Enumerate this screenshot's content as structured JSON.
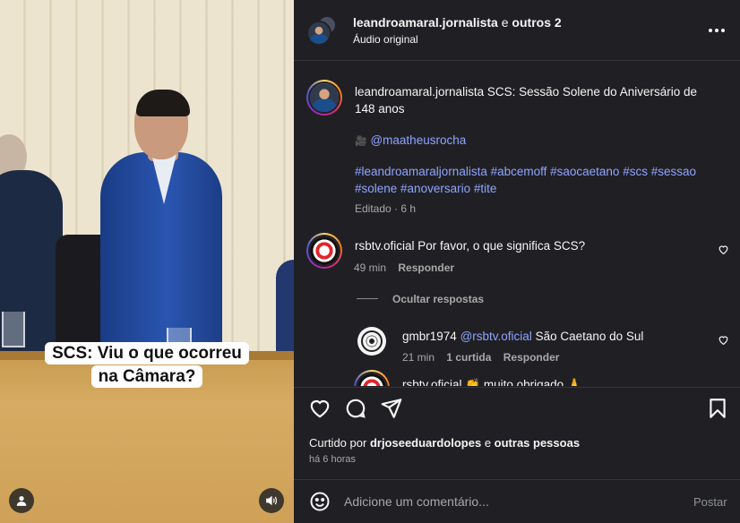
{
  "video": {
    "caption_line1": "SCS: Viu o que ocorreu",
    "caption_line2": "na Câmara?"
  },
  "header": {
    "username": "leandroamaral.jornalista",
    "collab_connector": "e",
    "collab_others": "outros 2",
    "audio": "Áudio original"
  },
  "caption_post": {
    "username": "leandroamaral.jornalista",
    "text": "SCS: Sessão Solene do Aniversário de 148 anos",
    "mention_emoji": "🎥",
    "mention": "@maatheusrocha",
    "hashtags_line1": "#leandroamaraljornalista #abcemoff #saocaetano #scs #sessao",
    "hashtags_line2": "#solene #anoversario #tite",
    "edited": "Editado · 6 h"
  },
  "comments": [
    {
      "username": "rsbtv.oficial",
      "text": "Por favor, o que significa SCS?",
      "time": "49 min",
      "reply_label": "Responder"
    }
  ],
  "hide_replies": "Ocultar respostas",
  "replies": [
    {
      "username": "gmbr1974",
      "mention": "@rsbtv.oficial",
      "text": "São Caetano do Sul",
      "time": "21 min",
      "likes": "1 curtida",
      "reply_label": "Responder"
    },
    {
      "username": "rsbtv.oficial",
      "text": "👏 muito obrigado 🙏"
    }
  ],
  "likes": {
    "prefix": "Curtido por",
    "user": "drjoseeduardolopes",
    "connector": "e",
    "others": "outras pessoas"
  },
  "timestamp": "há 6 horas",
  "add_comment": {
    "placeholder": "Adicione um comentário...",
    "post_label": "Postar"
  },
  "colors": {
    "panel_bg": "#202024",
    "link": "#8fa4ff",
    "muted": "#a8a8a8"
  },
  "icons": [
    "user-tag-icon",
    "volume-icon",
    "more-options-icon",
    "heart-icon",
    "comment-icon",
    "share-icon",
    "bookmark-icon",
    "emoji-icon"
  ]
}
